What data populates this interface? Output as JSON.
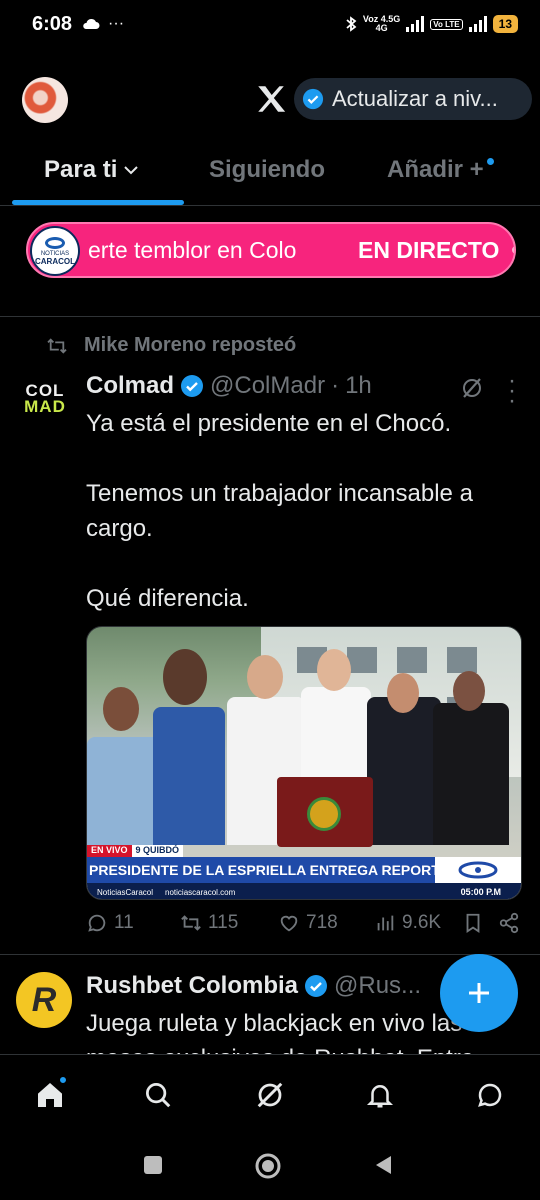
{
  "status_bar": {
    "time": "6:08",
    "network_label_top": "Voz 4.5G",
    "network_label_bottom": "4G",
    "volte": "Vo LTE",
    "battery": "13"
  },
  "header": {
    "upgrade_label": "Actualizar a niv..."
  },
  "tabs": [
    {
      "label": "Para ti",
      "active": true
    },
    {
      "label": "Siguiendo",
      "active": false
    },
    {
      "label": "Añadir +",
      "active": false
    }
  ],
  "live_banner": {
    "logo_line1": "NOTICIAS",
    "logo_line2": "CARACOL",
    "headline": "erte temblor en Colo",
    "tag": "EN DIRECTO"
  },
  "repost": {
    "text": "Mike Moreno reposteó"
  },
  "tweet": {
    "avatar_line1": "COL",
    "avatar_line2": "MAD",
    "name": "Colmad",
    "handle": "@ColMadr",
    "separator": "·",
    "time": "1h",
    "body": [
      "Ya está el presidente en el Chocó.",
      "",
      "Tenemos un trabajador incansable a",
      "cargo.",
      "",
      "Qué diferencia."
    ],
    "media": {
      "live_label": "EN VIVO",
      "location": "9 QUIBDÓ",
      "chyron": "PRESIDENTE DE LA ESPRIELLA ENTREGA REPORTE EN QUIBDÓ",
      "channel": "NoticiasCaracol",
      "site": "noticiascaracol.com",
      "clock": "05:00 P.M"
    },
    "stats": {
      "replies": "11",
      "reposts": "115",
      "likes": "718",
      "views": "9.6K"
    }
  },
  "next_tweet": {
    "avatar_letter": "R",
    "name": "Rushbet Colombia",
    "handle": "@Rus...",
    "body_line1": "Juega ruleta y blackjack en vivo las",
    "body_line2": "mesas exclusivas de Rushbet. Entra"
  },
  "colors": {
    "accent": "#1d9bf0",
    "live_pink": "#f7247d",
    "background": "#000000",
    "secondary_text": "#71767b"
  },
  "icons": {
    "home": "home-icon",
    "search": "search-icon",
    "grok": "grok-icon",
    "notifications": "bell-icon",
    "messages": "message-icon"
  }
}
